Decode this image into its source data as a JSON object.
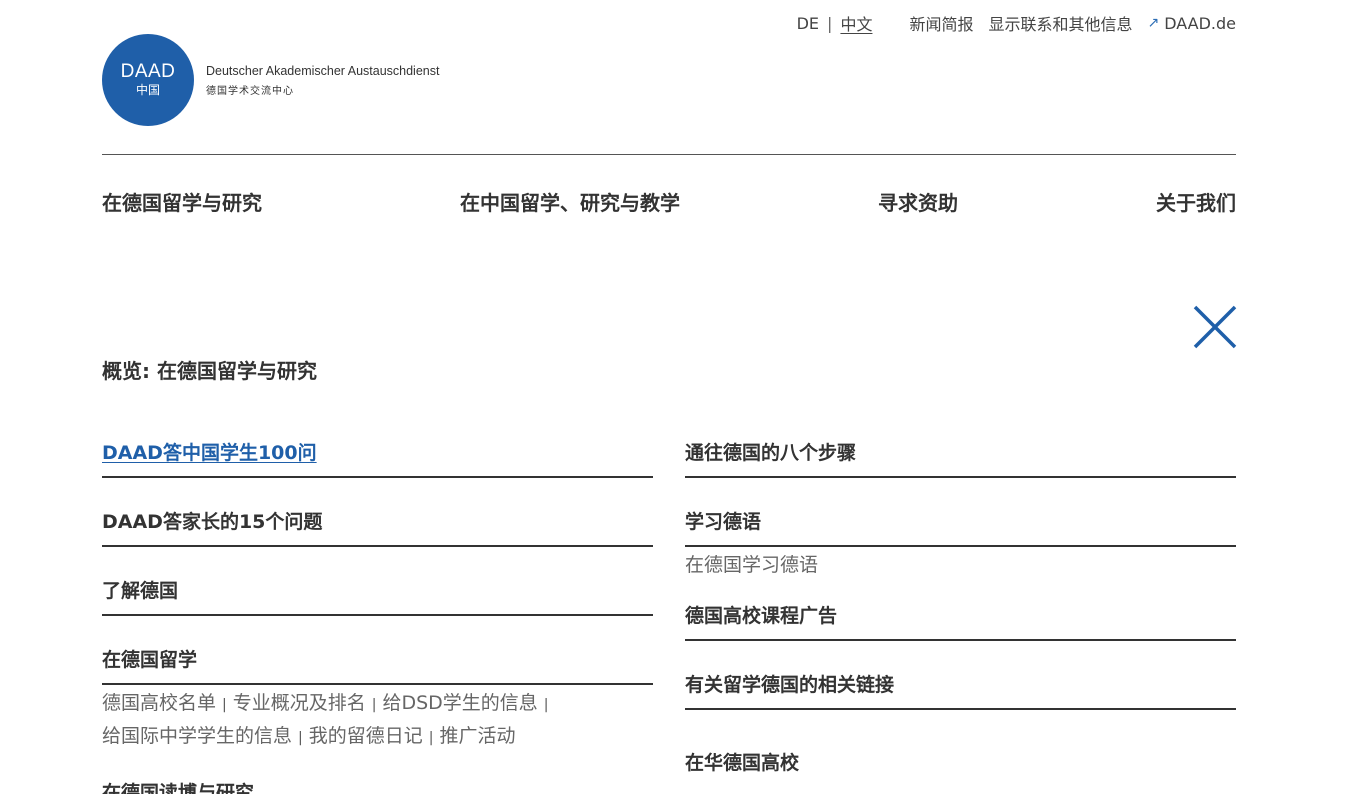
{
  "meta": {
    "lang_de": "DE",
    "lang_sep": "|",
    "lang_zh": "中文",
    "newsletter": "新闻简报",
    "contact": "显示联系和其他信息",
    "external_icon": "↗",
    "daad_link": "DAAD.de"
  },
  "logo": {
    "circle_line1": "DAAD",
    "circle_line2": "中国",
    "name_de": "Deutscher Akademischer Austauschdienst",
    "name_zh": "德国学术交流中心",
    "color": "#1f5fa9"
  },
  "nav": {
    "item1": "在德国留学与研究",
    "item2": "在中国留学、研究与教学",
    "item3": "寻求资助",
    "item4": "关于我们"
  },
  "overview": "概览: 在德国留学与研究",
  "left": {
    "e1": "DAAD答中国学生100问",
    "e2": "DAAD答家长的15个问题",
    "e3": "了解德国",
    "e4": "在德国留学",
    "sub1": "德国高校名单",
    "sub2": "专业概况及排名",
    "sub3": "给DSD学生的信息",
    "sub4": "给国际中学学生的信息",
    "sub5": "我的留德日记",
    "sub6": "推广活动",
    "e5": "在德国读博与研究"
  },
  "right": {
    "e1": "通往德国的八个步骤",
    "e2": "学习德语",
    "e2_sub": "在德国学习德语",
    "e3": "德国高校课程广告",
    "e4": "有关留学德国的相关链接",
    "e5": "在华德国高校"
  },
  "colors": {
    "accent": "#1f5fa9",
    "text": "#333333"
  }
}
